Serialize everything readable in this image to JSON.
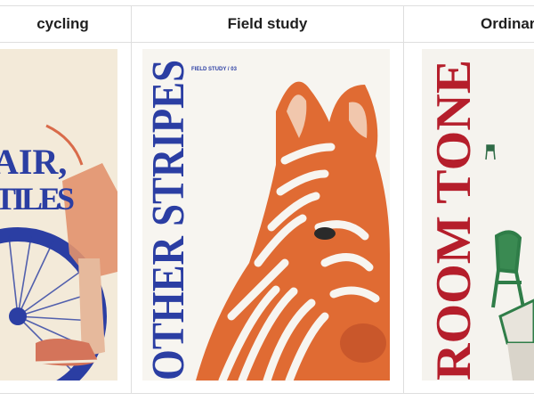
{
  "columns": [
    {
      "header": "cycling"
    },
    {
      "header": "Field study"
    },
    {
      "header": "Ordinar"
    }
  ],
  "covers": {
    "cycling": {
      "lines": [
        "AIR,",
        "TILES"
      ]
    },
    "field_study": {
      "kicker": "FIELD STUDY / 03",
      "title": "OTHER STRIPES"
    },
    "ordinary": {
      "title": "ROOM TONE"
    }
  }
}
